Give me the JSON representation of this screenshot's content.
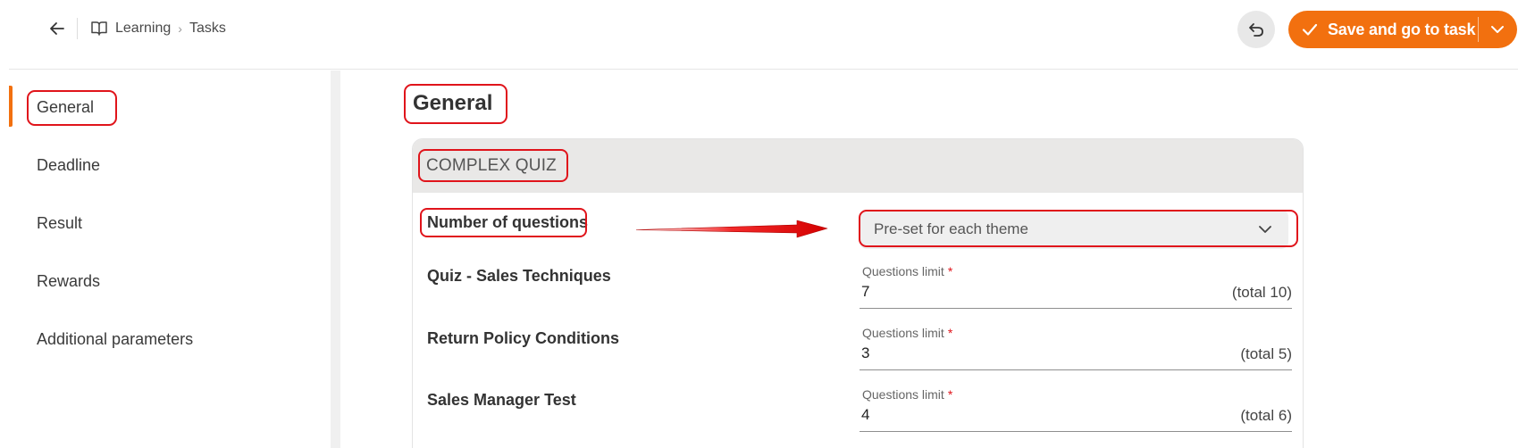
{
  "breadcrumb": {
    "items": [
      "Learning",
      "Tasks"
    ]
  },
  "toolbar": {
    "save_label": "Save and go to task"
  },
  "sidebar": {
    "items": [
      {
        "label": "General",
        "active": true
      },
      {
        "label": "Deadline"
      },
      {
        "label": "Result"
      },
      {
        "label": "Rewards"
      },
      {
        "label": "Additional parameters"
      }
    ]
  },
  "main": {
    "title": "General",
    "section_title": "COMPLEX QUIZ",
    "number_of_questions": {
      "label": "Number of questions",
      "value": "Pre-set for each theme"
    },
    "themes": [
      {
        "name": "Quiz - Sales Techniques",
        "limit_label": "Questions limit",
        "required": "*",
        "value": "7",
        "total": "(total 10)"
      },
      {
        "name": "Return Policy Conditions",
        "limit_label": "Questions limit",
        "required": "*",
        "value": "3",
        "total": "(total 5)"
      },
      {
        "name": "Sales Manager Test",
        "limit_label": "Questions limit",
        "required": "*",
        "value": "4",
        "total": "(total 6)"
      }
    ]
  },
  "colors": {
    "accent": "#f2700f",
    "annotation": "#e0141b",
    "card_header": "#e9e8e7",
    "select_bg": "#efefef"
  },
  "icons": {
    "back": "arrow-left-icon",
    "breadcrumb": "book-icon",
    "undo": "undo-icon",
    "save": "check-icon",
    "save_menu": "chevron-down-icon",
    "select": "chevron-down-icon"
  }
}
